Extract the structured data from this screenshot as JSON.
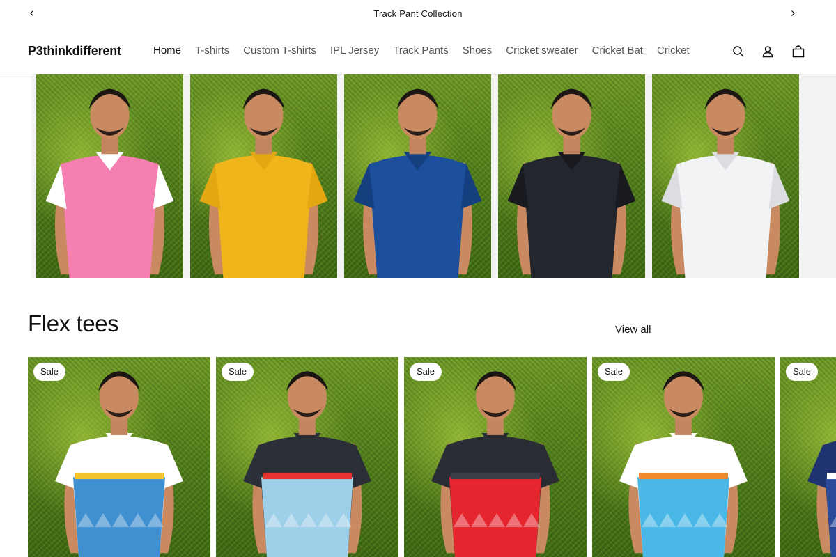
{
  "announcement": {
    "text": "Track Pant Collection",
    "prev_icon": "chevron-left-icon",
    "next_icon": "chevron-right-icon"
  },
  "header": {
    "logo": "P3thinkdifferent",
    "nav": [
      "Home",
      "T-shirts",
      "Custom T-shirts",
      "IPL Jersey",
      "Track Pants",
      "Shoes",
      "Cricket sweater",
      "Cricket Bat",
      "Cricket"
    ],
    "active_nav": "Home",
    "icons": [
      "search-icon",
      "account-icon",
      "cart-icon"
    ]
  },
  "hero": {
    "panels": [
      {
        "shirt": "#f47fb0",
        "shirt2": "#ffffff",
        "label": "pink-white polo"
      },
      {
        "shirt": "#f1b51c",
        "shirt2": "#e3a712",
        "label": "yellow polo"
      },
      {
        "shirt": "#1c4f9c",
        "shirt2": "#163f80",
        "label": "blue polo"
      },
      {
        "shirt": "#23262c",
        "shirt2": "#181a1f",
        "label": "black polo"
      },
      {
        "shirt": "#f2f3f5",
        "shirt2": "#dcdde0",
        "label": "white polo"
      }
    ]
  },
  "collection": {
    "title": "Flex tees",
    "view_all": "View all",
    "products": [
      {
        "badge": "Sale",
        "top": "#ffffff",
        "body": "#3f8fd1",
        "accent": "#f0c22b"
      },
      {
        "badge": "Sale",
        "top": "#2b2f38",
        "body": "#9fd0ea",
        "accent": "#e8322f"
      },
      {
        "badge": "Sale",
        "top": "#2a2d34",
        "body": "#e5262e",
        "accent": "#3a3f48"
      },
      {
        "badge": "Sale",
        "top": "#ffffff",
        "body": "#4ab8e6",
        "accent": "#f08a2a"
      },
      {
        "badge": "Sale",
        "top": "#1f3370",
        "body": "#2a4a9a",
        "accent": "#ffffff"
      }
    ]
  }
}
